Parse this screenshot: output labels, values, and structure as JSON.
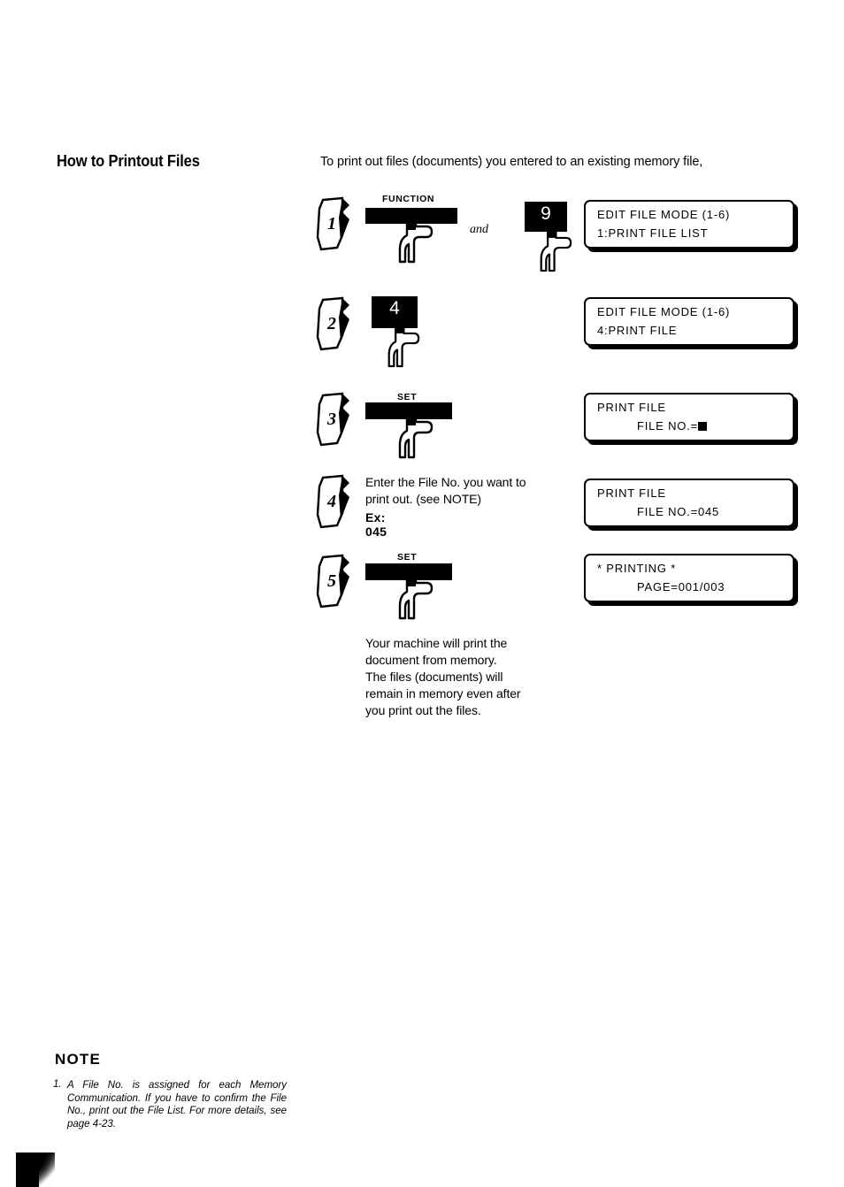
{
  "page": {
    "section_title": "How to Printout Files",
    "intro": "To print out files (documents) you entered to an existing memory file,"
  },
  "steps": [
    {
      "number": "1",
      "key_label": "FUNCTION",
      "second_key": "9",
      "conjunction": "and",
      "lcd": {
        "line1": "EDIT  FILE  MODE  (1-6)",
        "line2": "1:PRINT  FILE  LIST"
      }
    },
    {
      "number": "2",
      "key_label": "",
      "second_key": "4",
      "lcd": {
        "line1": "EDIT  FILE  MODE  (1-6)",
        "line2": "4:PRINT  FILE"
      }
    },
    {
      "number": "3",
      "key_label": "SET",
      "lcd": {
        "line1": "PRINT  FILE",
        "line2": "FILE  NO.="
      }
    },
    {
      "number": "4",
      "instruction": "Enter the File No. you want to\nprint out. (see NOTE)",
      "example": "Ex:  045",
      "lcd": {
        "line1": "PRINT  FILE",
        "line2": "FILE  NO.=045"
      }
    },
    {
      "number": "5",
      "key_label": "SET",
      "lcd": {
        "line1": "*  PRINTING  *",
        "line2": "PAGE=001/003"
      }
    }
  ],
  "closing_text": "Your machine will print the\ndocument from memory.\nThe files (documents) will\nremain in memory even after\nyou print out the files.",
  "note": {
    "title": "NOTE",
    "number": "1.",
    "body": "A File No. is assigned for each Memory Communication. If you have to confirm the File No., print out the File List. For more details, see page 4-23."
  },
  "colors": {
    "ink": "#000000",
    "paper": "#ffffff"
  }
}
